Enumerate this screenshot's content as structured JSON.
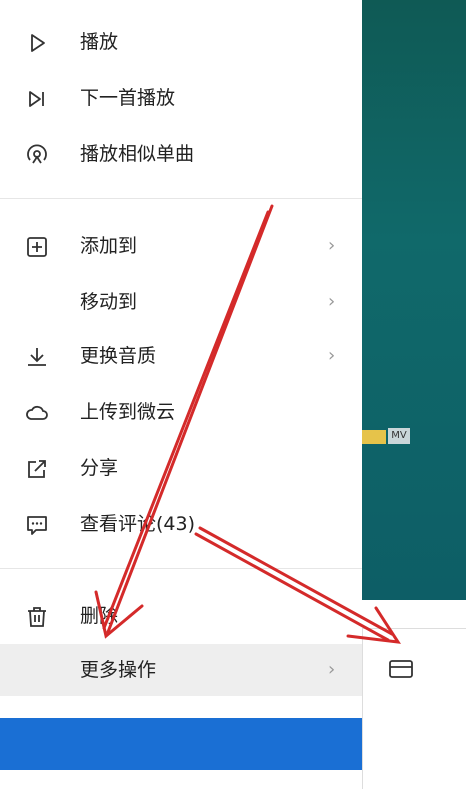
{
  "menu": {
    "items": [
      {
        "id": "play",
        "label": "播放",
        "icon": "play-icon",
        "arrow": ""
      },
      {
        "id": "next",
        "label": "下一首播放",
        "icon": "play-next-icon",
        "arrow": ""
      },
      {
        "id": "similar",
        "label": "播放相似单曲",
        "icon": "radio-icon",
        "arrow": ""
      },
      {
        "id": "add",
        "label": "添加到",
        "icon": "add-square-icon",
        "arrow": "›"
      },
      {
        "id": "move",
        "label": "移动到",
        "icon": "",
        "arrow": "›"
      },
      {
        "id": "quality",
        "label": "更换音质",
        "icon": "download-icon",
        "arrow": "›"
      },
      {
        "id": "upload",
        "label": "上传到微云",
        "icon": "cloud-icon",
        "arrow": ""
      },
      {
        "id": "share",
        "label": "分享",
        "icon": "share-icon",
        "arrow": ""
      },
      {
        "id": "comments",
        "label": "查看评论(43)",
        "icon": "comment-icon",
        "arrow": ""
      },
      {
        "id": "delete",
        "label": "删除",
        "icon": "trash-icon",
        "arrow": ""
      },
      {
        "id": "more",
        "label": "更多操作",
        "icon": "",
        "arrow": "›"
      }
    ]
  },
  "background": {
    "badge_text": "MV"
  },
  "colors": {
    "annotation_arrow": "#d42a2a",
    "hover": "#eeeeee",
    "selection_bar": "#1a6fd4",
    "panel_bg": "#0f5a55"
  }
}
